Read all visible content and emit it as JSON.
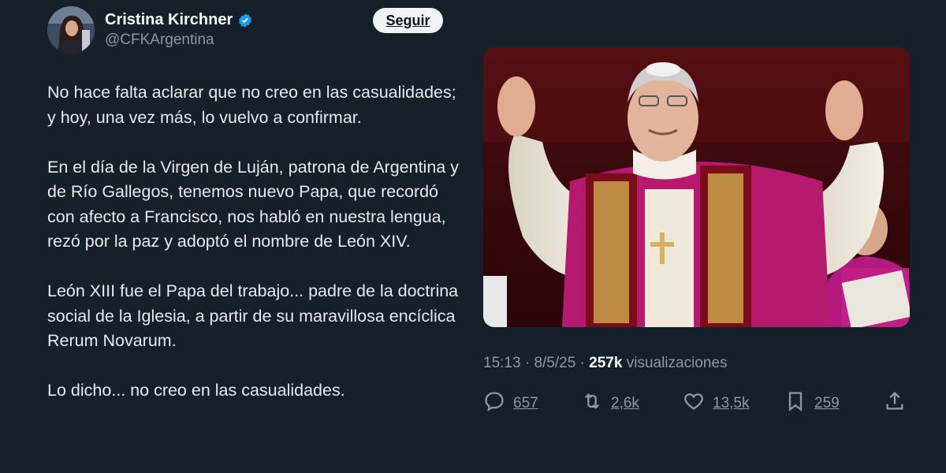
{
  "author": {
    "display_name": "Cristina Kirchner",
    "handle": "@CFKArgentina",
    "follow_label": "Seguir"
  },
  "tweet": {
    "paragraphs": [
      "No hace falta aclarar que no creo en las casualidades; y hoy, una vez más, lo vuelvo a confirmar.",
      "En el día de la Virgen de Luján, patrona de Argentina y de Río Gallegos, tenemos nuevo Papa, que recordó con afecto a Francisco, nos habló en nuestra lengua, rezó por la paz y adoptó el nombre de León XIV.",
      "León XIII fue el Papa del trabajo... padre de la doctrina social de la Iglesia, a partir de su maravillosa encíclica Rerum Novarum.",
      "Lo dicho... no creo en las casualidades."
    ],
    "time": "15:13",
    "date": "8/5/25",
    "views_count": "257k",
    "views_label": "visualizaciones"
  },
  "actions": {
    "replies": "657",
    "retweets": "2,6k",
    "likes": "13,5k",
    "bookmarks": "259"
  },
  "icons": {
    "verified": "verified-badge-icon",
    "reply": "reply-icon",
    "retweet": "retweet-icon",
    "like": "heart-icon",
    "bookmark": "bookmark-icon",
    "share": "share-icon"
  },
  "colors": {
    "background": "#15202b",
    "text": "#e7e9ea",
    "muted": "#8b98a5",
    "verified": "#1d9bf0"
  }
}
